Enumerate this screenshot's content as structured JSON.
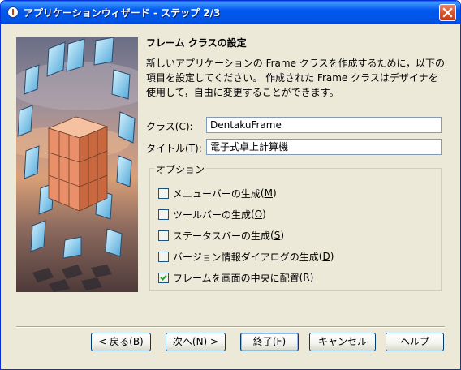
{
  "window": {
    "title": "アプリケーションウィザード - ステップ 2/3"
  },
  "heading": "フレーム クラスの設定",
  "description": [
    "新しいアプリケーションの Frame クラスを作成するために，以下の",
    "項目を設定してください。 作成された Frame クラスはデザイナを",
    "使用して，自由に変更することができます。"
  ],
  "fields": {
    "class": {
      "label": "クラス",
      "mnemonic": "C",
      "value": "DentakuFrame"
    },
    "title": {
      "label": "タイトル",
      "mnemonic": "T",
      "value": "電子式卓上計算機"
    }
  },
  "options": {
    "legend": "オプション",
    "items": [
      {
        "label": "メニューバーの生成",
        "mnemonic": "M",
        "checked": false
      },
      {
        "label": "ツールバーの生成",
        "mnemonic": "O",
        "checked": false
      },
      {
        "label": "ステータスバーの生成",
        "mnemonic": "S",
        "checked": false
      },
      {
        "label": "バージョン情報ダイアログの生成",
        "mnemonic": "D",
        "checked": false
      },
      {
        "label": "フレームを画面の中央に配置",
        "mnemonic": "R",
        "checked": true
      }
    ]
  },
  "buttons": {
    "back": {
      "pre": "< 戻る(",
      "mn": "B",
      "post": ")"
    },
    "next": {
      "pre": "次へ(",
      "mn": "N",
      "post": ") >"
    },
    "finish": {
      "pre": "終了(",
      "mn": "F",
      "post": ")"
    },
    "cancel": "キャンセル",
    "help": "ヘルプ"
  },
  "colors": {
    "titlebar": "#0054e3",
    "window_bg": "#ece9d8",
    "close_button": "#d8552d"
  }
}
